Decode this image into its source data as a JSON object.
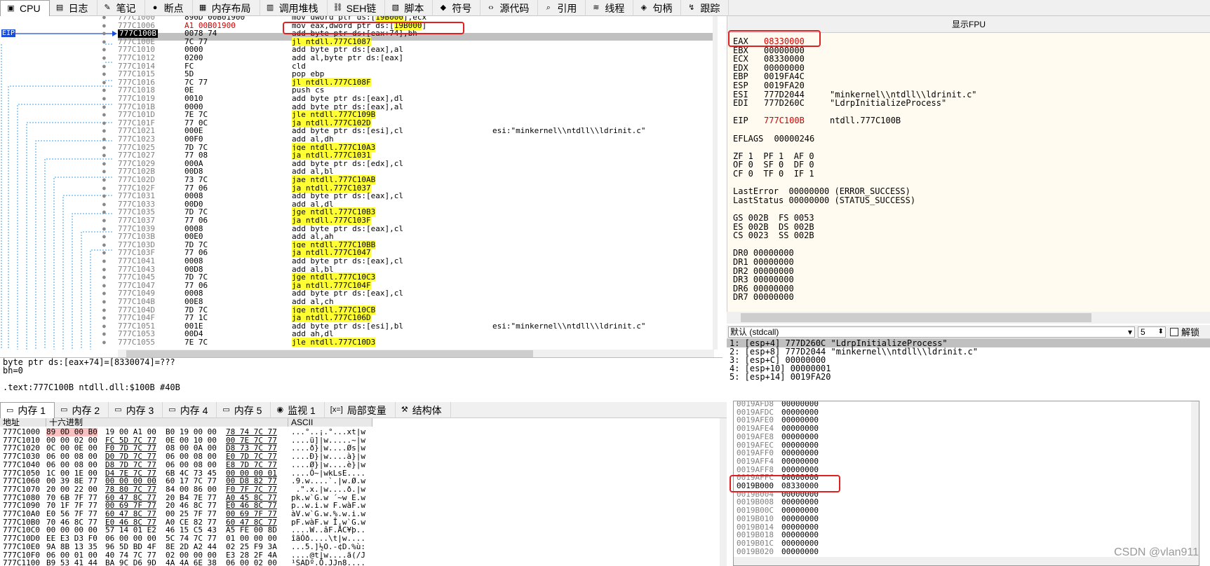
{
  "tabs": [
    {
      "label": "CPU",
      "icon": "cpu-icon",
      "glyph": "▣",
      "active": true
    },
    {
      "label": "日志",
      "icon": "log-icon",
      "glyph": "▤"
    },
    {
      "label": "笔记",
      "icon": "notes-icon",
      "glyph": "✎"
    },
    {
      "label": "断点",
      "icon": "breakpoint-icon",
      "glyph": "●"
    },
    {
      "label": "内存布局",
      "icon": "memory-map-icon",
      "glyph": "▦"
    },
    {
      "label": "调用堆栈",
      "icon": "call-stack-icon",
      "glyph": "▥"
    },
    {
      "label": "SEH链",
      "icon": "seh-icon",
      "glyph": "⛓"
    },
    {
      "label": "脚本",
      "icon": "script-icon",
      "glyph": "▧"
    },
    {
      "label": "符号",
      "icon": "symbols-icon",
      "glyph": "◆"
    },
    {
      "label": "源代码",
      "icon": "source-icon",
      "glyph": "‹›"
    },
    {
      "label": "引用",
      "icon": "references-icon",
      "glyph": "⌕"
    },
    {
      "label": "线程",
      "icon": "threads-icon",
      "glyph": "≋"
    },
    {
      "label": "句柄",
      "icon": "handles-icon",
      "glyph": "◈"
    },
    {
      "label": "跟踪",
      "icon": "trace-icon",
      "glyph": "↯"
    }
  ],
  "eip_label": "EIP",
  "disasm": [
    {
      "addr": "777C1000",
      "bytes": "890D 00B01900",
      "ins": [
        [
          "mov dword ptr ds:[",
          ""
        ],
        [
          "19B000",
          "hl"
        ],
        [
          "],ecx",
          ""
        ]
      ],
      "cmt": ""
    },
    {
      "addr": "777C1006",
      "bytes": "A1 00B01900",
      "red": true,
      "ins": [
        [
          "mov eax,dword ptr ds:[",
          ""
        ],
        [
          "19B000",
          "hl"
        ],
        [
          "]",
          ""
        ]
      ],
      "cmt": ""
    },
    {
      "addr": "777C100B",
      "bytes": "0078 74",
      "sel": true,
      "ins": [
        [
          "add byte ptr ds:[eax+74],bh",
          ""
        ]
      ],
      "cmt": ""
    },
    {
      "addr": "777C100E",
      "bytes": "7C 77",
      "ins": [
        [
          "jl ntdll.777C1087",
          "hl"
        ]
      ],
      "cmt": ""
    },
    {
      "addr": "777C1010",
      "bytes": "0000",
      "ins": [
        [
          "add byte ptr ds:[eax],al",
          ""
        ]
      ],
      "cmt": ""
    },
    {
      "addr": "777C1012",
      "bytes": "0200",
      "ins": [
        [
          "add al,byte ptr ds:[eax]",
          ""
        ]
      ],
      "cmt": ""
    },
    {
      "addr": "777C1014",
      "bytes": "FC",
      "ins": [
        [
          "cld",
          ""
        ]
      ],
      "cmt": ""
    },
    {
      "addr": "777C1015",
      "bytes": "5D",
      "ins": [
        [
          "pop ebp",
          ""
        ]
      ],
      "cmt": ""
    },
    {
      "addr": "777C1016",
      "bytes": "7C 77",
      "ins": [
        [
          "jl ntdll.777C108F",
          "hl"
        ]
      ],
      "cmt": ""
    },
    {
      "addr": "777C1018",
      "bytes": "0E",
      "ins": [
        [
          "push cs",
          ""
        ]
      ],
      "cmt": ""
    },
    {
      "addr": "777C1019",
      "bytes": "0010",
      "ins": [
        [
          "add byte ptr ds:[eax],dl",
          ""
        ]
      ],
      "cmt": ""
    },
    {
      "addr": "777C101B",
      "bytes": "0000",
      "ins": [
        [
          "add byte ptr ds:[eax],al",
          ""
        ]
      ],
      "cmt": ""
    },
    {
      "addr": "777C101D",
      "bytes": "7E 7C",
      "ins": [
        [
          "jle ntdll.777C109B",
          "hl"
        ]
      ],
      "cmt": ""
    },
    {
      "addr": "777C101F",
      "bytes": "77 0C",
      "ins": [
        [
          "ja ntdll.777C102D",
          "hl"
        ]
      ],
      "cmt": ""
    },
    {
      "addr": "777C1021",
      "bytes": "000E",
      "ins": [
        [
          "add byte ptr ds:[esi],cl",
          ""
        ]
      ],
      "cmt": "esi:\"minkernel\\\\ntdll\\\\ldrinit.c\""
    },
    {
      "addr": "777C1023",
      "bytes": "00F0",
      "ins": [
        [
          "add al,dh",
          ""
        ]
      ],
      "cmt": ""
    },
    {
      "addr": "777C1025",
      "bytes": "7D 7C",
      "ins": [
        [
          "jge ntdll.777C10A3",
          "hl"
        ]
      ],
      "cmt": ""
    },
    {
      "addr": "777C1027",
      "bytes": "77 08",
      "ins": [
        [
          "ja ntdll.777C1031",
          "hl"
        ]
      ],
      "cmt": ""
    },
    {
      "addr": "777C1029",
      "bytes": "000A",
      "ins": [
        [
          "add byte ptr ds:[edx],cl",
          ""
        ]
      ],
      "cmt": ""
    },
    {
      "addr": "777C102B",
      "bytes": "00D8",
      "ins": [
        [
          "add al,bl",
          ""
        ]
      ],
      "cmt": ""
    },
    {
      "addr": "777C102D",
      "bytes": "73 7C",
      "ins": [
        [
          "jae ntdll.777C10AB",
          "hl"
        ]
      ],
      "cmt": ""
    },
    {
      "addr": "777C102F",
      "bytes": "77 06",
      "ins": [
        [
          "ja ntdll.777C1037",
          "hl"
        ]
      ],
      "cmt": ""
    },
    {
      "addr": "777C1031",
      "bytes": "0008",
      "ins": [
        [
          "add byte ptr ds:[eax],cl",
          ""
        ]
      ],
      "cmt": ""
    },
    {
      "addr": "777C1033",
      "bytes": "00D0",
      "ins": [
        [
          "add al,dl",
          ""
        ]
      ],
      "cmt": ""
    },
    {
      "addr": "777C1035",
      "bytes": "7D 7C",
      "ins": [
        [
          "jge ntdll.777C10B3",
          "hl"
        ]
      ],
      "cmt": ""
    },
    {
      "addr": "777C1037",
      "bytes": "77 06",
      "ins": [
        [
          "ja ntdll.777C103F",
          "hl"
        ]
      ],
      "cmt": ""
    },
    {
      "addr": "777C1039",
      "bytes": "0008",
      "ins": [
        [
          "add byte ptr ds:[eax],cl",
          ""
        ]
      ],
      "cmt": ""
    },
    {
      "addr": "777C103B",
      "bytes": "00E0",
      "ins": [
        [
          "add al,ah",
          ""
        ]
      ],
      "cmt": ""
    },
    {
      "addr": "777C103D",
      "bytes": "7D 7C",
      "ins": [
        [
          "jge ntdll.777C10BB",
          "hl"
        ]
      ],
      "cmt": ""
    },
    {
      "addr": "777C103F",
      "bytes": "77 06",
      "ins": [
        [
          "ja ntdll.777C1047",
          "hl"
        ]
      ],
      "cmt": ""
    },
    {
      "addr": "777C1041",
      "bytes": "0008",
      "ins": [
        [
          "add byte ptr ds:[eax],cl",
          ""
        ]
      ],
      "cmt": ""
    },
    {
      "addr": "777C1043",
      "bytes": "00D8",
      "ins": [
        [
          "add al,bl",
          ""
        ]
      ],
      "cmt": ""
    },
    {
      "addr": "777C1045",
      "bytes": "7D 7C",
      "ins": [
        [
          "jge ntdll.777C10C3",
          "hl"
        ]
      ],
      "cmt": ""
    },
    {
      "addr": "777C1047",
      "bytes": "77 06",
      "ins": [
        [
          "ja ntdll.777C104F",
          "hl"
        ]
      ],
      "cmt": ""
    },
    {
      "addr": "777C1049",
      "bytes": "0008",
      "ins": [
        [
          "add byte ptr ds:[eax],cl",
          ""
        ]
      ],
      "cmt": ""
    },
    {
      "addr": "777C104B",
      "bytes": "00E8",
      "ins": [
        [
          "add al,ch",
          ""
        ]
      ],
      "cmt": ""
    },
    {
      "addr": "777C104D",
      "bytes": "7D 7C",
      "ins": [
        [
          "jge ntdll.777C10CB",
          "hl"
        ]
      ],
      "cmt": ""
    },
    {
      "addr": "777C104F",
      "bytes": "77 1C",
      "ins": [
        [
          "ja ntdll.777C106D",
          "hl"
        ]
      ],
      "cmt": ""
    },
    {
      "addr": "777C1051",
      "bytes": "001E",
      "ins": [
        [
          "add byte ptr ds:[esi],bl",
          ""
        ]
      ],
      "cmt": "esi:\"minkernel\\\\ntdll\\\\ldrinit.c\""
    },
    {
      "addr": "777C1053",
      "bytes": "00D4",
      "ins": [
        [
          "add ah,dl",
          ""
        ]
      ],
      "cmt": ""
    },
    {
      "addr": "777C1055",
      "bytes": "7E 7C",
      "ins": [
        [
          "jle ntdll.777C10D3",
          "hl"
        ]
      ],
      "cmt": ""
    }
  ],
  "dis_info": [
    "byte ptr ds:[eax+74]=[8330074]=???",
    "bh=0",
    "",
    ".text:777C100B ntdll.dll:$100B #40B"
  ],
  "fpu_title": "显示FPU",
  "registers": [
    {
      "name": "EAX",
      "val": "08330000",
      "red": true,
      "cmt": ""
    },
    {
      "name": "EBX",
      "val": "00000000",
      "cmt": ""
    },
    {
      "name": "ECX",
      "val": "08330000",
      "cmt": ""
    },
    {
      "name": "EDX",
      "val": "00000000",
      "cmt": ""
    },
    {
      "name": "EBP",
      "val": "0019FA4C",
      "cmt": ""
    },
    {
      "name": "ESP",
      "val": "0019FA20",
      "cmt": ""
    },
    {
      "name": "ESI",
      "val": "777D2044",
      "cmt": "\"minkernel\\\\ntdll\\\\ldrinit.c\""
    },
    {
      "name": "EDI",
      "val": "777D260C",
      "cmt": "\"LdrpInitializeProcess\""
    },
    {
      "name": "",
      "val": "",
      "cmt": ""
    },
    {
      "name": "EIP",
      "val": "777C100B",
      "red": true,
      "cmt": "ntdll.777C100B"
    },
    {
      "name": "",
      "val": "",
      "cmt": ""
    },
    {
      "name": "EFLAGS",
      "val": "  00000246",
      "cmt": ""
    }
  ],
  "flags": [
    "ZF 1  PF 1  AF 0",
    "OF 0  SF 0  DF 0",
    "CF 0  TF 0  IF 1"
  ],
  "errors": [
    "LastError  00000000 (ERROR_SUCCESS)",
    "LastStatus 00000000 (STATUS_SUCCESS)"
  ],
  "segs": [
    "GS 002B  FS 0053",
    "ES 002B  DS 002B",
    "CS 0023  SS 002B"
  ],
  "dregs": [
    "DR0 00000000",
    "DR1 00000000",
    "DR2 00000000",
    "DR3 00000000",
    "DR6 00000000",
    "DR7 00000000"
  ],
  "callconv": "默认 (stdcall)",
  "argcount": "5",
  "unlock_label": "解锁",
  "args": [
    "1: [esp+4] 777D260C \"LdrpInitializeProcess\"",
    "2: [esp+8] 777D2044 \"minkernel\\\\ntdll\\\\ldrinit.c\"",
    "3: [esp+C] 00000000",
    "4: [esp+10] 00000001",
    "5: [esp+14] 0019FA20"
  ],
  "mem_tabs": [
    {
      "label": "内存 1",
      "icon": "memory-icon",
      "glyph": "▭",
      "active": true
    },
    {
      "label": "内存 2",
      "icon": "memory-icon",
      "glyph": "▭"
    },
    {
      "label": "内存 3",
      "icon": "memory-icon",
      "glyph": "▭"
    },
    {
      "label": "内存 4",
      "icon": "memory-icon",
      "glyph": "▭"
    },
    {
      "label": "内存 5",
      "icon": "memory-icon",
      "glyph": "▭"
    },
    {
      "label": "监视 1",
      "icon": "watch-icon",
      "glyph": "◉"
    },
    {
      "label": "局部变量",
      "icon": "locals-icon",
      "glyph": "[x=]"
    },
    {
      "label": "结构体",
      "icon": "struct-icon",
      "glyph": "⚒"
    }
  ],
  "hex_headers": {
    "addr": "地址",
    "hex": "十六进制",
    "ascii": "ASCII"
  },
  "hex_rows": [
    {
      "addr": "777C1000",
      "hex": [
        "89 0D 00 B0",
        "19 00 A1 00",
        "B0 19 00 00",
        "78 74 7C 77"
      ],
      "ascii": "...°..¡.°...xt|w"
    },
    {
      "addr": "777C1010",
      "hex": [
        "00 00 02 00",
        "FC 5D 7C 77",
        "0E 00 10 00",
        "00 7E 7C 77"
      ],
      "ascii": "....ü]|w.....~|w"
    },
    {
      "addr": "777C1020",
      "hex": [
        "0C 00 0E 00",
        "F0 7D 7C 77",
        "08 00 0A 00",
        "D8 73 7C 77"
      ],
      "ascii": "....ð}|w....Øs|w"
    },
    {
      "addr": "777C1030",
      "hex": [
        "06 00 08 00",
        "D0 7D 7C 77",
        "06 00 08 00",
        "E0 7D 7C 77"
      ],
      "ascii": "....Ð}|w....à}|w"
    },
    {
      "addr": "777C1040",
      "hex": [
        "06 00 08 00",
        "D8 7D 7C 77",
        "06 00 08 00",
        "E8 7D 7C 77"
      ],
      "ascii": "....Ø}|w....è}|w"
    },
    {
      "addr": "777C1050",
      "hex": [
        "1C 00 1E 00",
        "D4 7E 7C 77",
        "6B 4C 73 45",
        "00 00 00 01"
      ],
      "ascii": "....Ô~|wkLsE...."
    },
    {
      "addr": "777C1060",
      "hex": [
        "00 39 8E 77",
        "00 00 00 00",
        "60 17 7C 77",
        "00 D8 82 77"
      ],
      "ascii": ".9.w....`.|w.Ø.w"
    },
    {
      "addr": "777C1070",
      "hex": [
        "20 00 22 00",
        "78 80 7C 77",
        "84 00 86 00",
        "F0 7F 7C 77"
      ],
      "ascii": " .\".x.|w....ð.|w"
    },
    {
      "addr": "777C1080",
      "hex": [
        "70 6B 7F 77",
        "60 47 8C 77",
        "20 B4 7E 77",
        "A0 45 8C 77"
      ],
      "ascii": "pk.w`G.w ´~w E.w"
    },
    {
      "addr": "777C1090",
      "hex": [
        "70 1F 7F 77",
        "00 69 7F 77",
        "20 46 8C 77",
        "E0 46 8C 77"
      ],
      "ascii": "p..w.i.w F.wàF.w"
    },
    {
      "addr": "777C10A0",
      "hex": [
        "E0 56 7F 77",
        "60 47 8C 77",
        "00 25 7F 77",
        "00 69 7F 77"
      ],
      "ascii": "àV.w`G.w.%.w.i.w"
    },
    {
      "addr": "777C10B0",
      "hex": [
        "70 46 8C 77",
        "E0 46 8C 77",
        "A0 CE 82 77",
        "60 47 8C 77"
      ],
      "ascii": "pF.wàF.w Î.w`G.w"
    },
    {
      "addr": "777C10C0",
      "hex": [
        "00 00 00 00",
        "57 14 01 E2",
        "46 15 C5 43",
        "A5 FE 00 8D"
      ],
      "ascii": "....W..âF.ÅC¥þ.."
    },
    {
      "addr": "777C10D0",
      "hex": [
        "EE E3 D3 F0",
        "06 00 00 00",
        "5C 74 7C 77",
        "01 00 00 00"
      ],
      "ascii": "îãÓð....\\t|w...."
    },
    {
      "addr": "777C10E0",
      "hex": [
        "9A 8B 13 35",
        "96 5D BD 4F",
        "8E 2D A2 44",
        "02 25 F9 3A"
      ],
      "ascii": "...5.]½O.-¢D.%ù:"
    },
    {
      "addr": "777C10F0",
      "hex": [
        "06 00 01 00",
        "40 74 7C 77",
        "02 00 00 00",
        "E3 28 2F 4A"
      ],
      "ascii": "....@t|w....ã(/J"
    },
    {
      "addr": "777C1100",
      "hex": [
        "B9 53 41 44",
        "BA 9C D6 9D",
        "4A 4A 6E 38",
        "06 00 02 00"
      ],
      "ascii": "¹SADº.Ö.JJn8...."
    }
  ],
  "stack_rows": [
    {
      "addr": "0019AFD8",
      "val": "00000000"
    },
    {
      "addr": "0019AFDC",
      "val": "00000000"
    },
    {
      "addr": "0019AFE0",
      "val": "00000000"
    },
    {
      "addr": "0019AFE4",
      "val": "00000000"
    },
    {
      "addr": "0019AFE8",
      "val": "00000000"
    },
    {
      "addr": "0019AFEC",
      "val": "00000000"
    },
    {
      "addr": "0019AFF0",
      "val": "00000000"
    },
    {
      "addr": "0019AFF4",
      "val": "00000000"
    },
    {
      "addr": "0019AFF8",
      "val": "00000000"
    },
    {
      "addr": "0019AFFC",
      "val": "00000000"
    },
    {
      "addr": "0019B000",
      "val": "08330000",
      "hl": true
    },
    {
      "addr": "0019B004",
      "val": "00000000"
    },
    {
      "addr": "0019B008",
      "val": "00000000"
    },
    {
      "addr": "0019B00C",
      "val": "00000000"
    },
    {
      "addr": "0019B010",
      "val": "00000000"
    },
    {
      "addr": "0019B014",
      "val": "00000000"
    },
    {
      "addr": "0019B018",
      "val": "00000000"
    },
    {
      "addr": "0019B01C",
      "val": "00000000"
    },
    {
      "addr": "0019B020",
      "val": "00000000"
    }
  ],
  "watermark": "CSDN @vlan911",
  "colors": {
    "highlight": "#ffff33",
    "red": "#d40000",
    "selection": "#c0c0c0",
    "annotation": "#e02020"
  }
}
